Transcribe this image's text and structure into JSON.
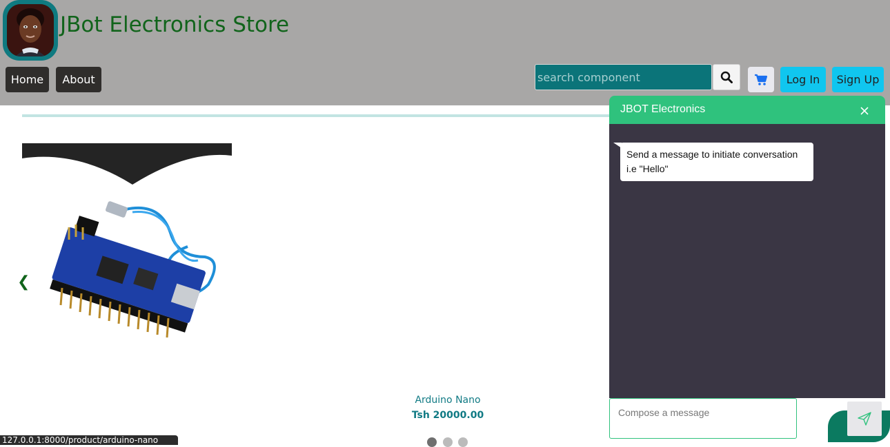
{
  "header": {
    "title": "JBot Electronics Store",
    "nav": {
      "home": "Home",
      "about": "About"
    },
    "search": {
      "placeholder": "search component"
    },
    "auth": {
      "login": "Log In",
      "signup": "Sign Up"
    },
    "icons": {
      "avatar": "avatar-icon",
      "search": "search-icon",
      "cart": "cart-icon"
    }
  },
  "main": {
    "carousel": {
      "prev_label": "❮",
      "product": {
        "name": "Arduino Nano",
        "price": "Tsh 20000.00"
      },
      "dots": 3,
      "active_dot": 1
    }
  },
  "status_bar": {
    "url": "127.0.0.1:8000/product/arduino-nano"
  },
  "chat": {
    "title": "JBOT Electronics",
    "message": "Send a message to initiate conversation i.e \"Hello\"",
    "composer_placeholder": "Compose a message",
    "icons": {
      "close": "close-icon",
      "send": "send-icon"
    }
  },
  "colors": {
    "header_bg": "#a8a7a6",
    "title_green": "#11641b",
    "search_bg": "#0b7479",
    "accent_cyan": "#10c6ef",
    "chat_green": "#2fc27d",
    "chat_body": "#3a3644",
    "price_teal": "#107a84"
  }
}
